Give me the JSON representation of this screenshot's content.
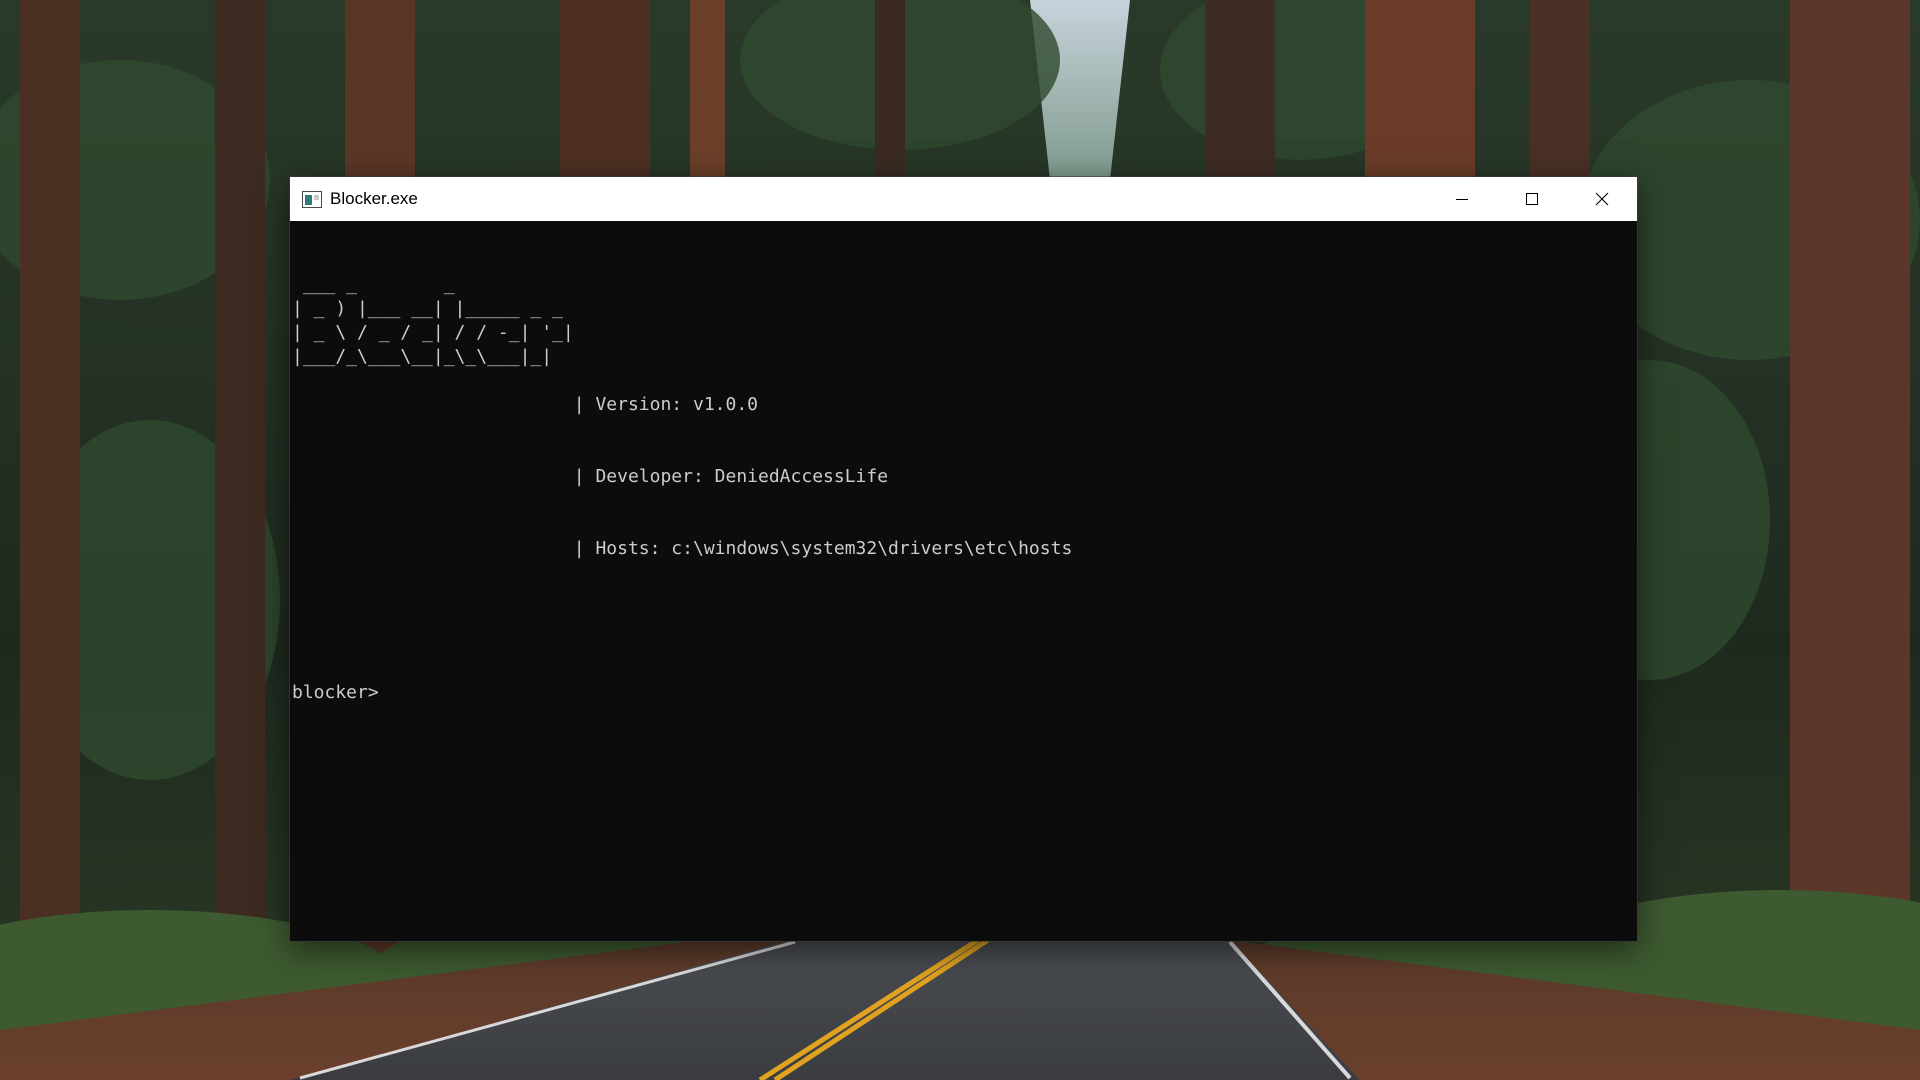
{
  "window": {
    "title": "Blocker.exe",
    "controls": {
      "minimize_icon": "minimize-icon",
      "maximize_icon": "maximize-icon",
      "close_icon": "close-icon"
    }
  },
  "console": {
    "ascii_art": " ___ _        _\n| _ ) |___ __| |_____ _ _\n| _ \\ / _ / _| / / -_| '_|\n|___/_\\___\\__|_\\_\\___|_|",
    "separator": "|",
    "version_line": "Version: v1.0.0",
    "developer_line": "Developer: DeniedAccessLife",
    "hosts_line": "Hosts: c:\\windows\\system32\\drivers\\etc\\hosts",
    "prompt": "blocker>",
    "input_value": ""
  },
  "colors": {
    "console_background": "#0c0c0c",
    "console_text": "#cccccc",
    "titlebar_background": "#ffffff"
  }
}
